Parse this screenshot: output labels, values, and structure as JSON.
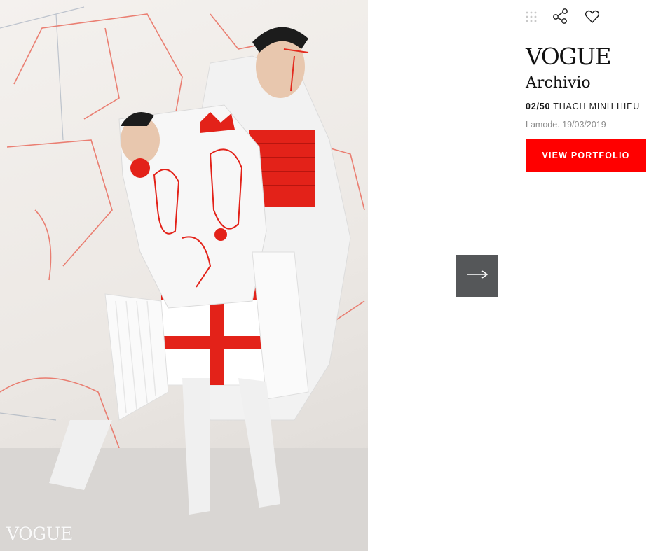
{
  "photo": {
    "watermark": "VOGUE"
  },
  "toolbar": {
    "icons": [
      "grid-icon",
      "share-icon",
      "heart-icon"
    ]
  },
  "brand": {
    "logo": "VOGUE",
    "sub": "Archivio"
  },
  "gallery": {
    "counter": "02/50",
    "designer": "THACH MINH HIEU",
    "meta": "Lamode. 19/03/2019",
    "portfolio_label": "VIEW PORTFOLIO"
  },
  "navigation": {
    "next_icon": "arrow-right-icon"
  },
  "colors": {
    "accent": "#ff0000",
    "nav_bg": "#555759",
    "muted_text": "#8b8b8b"
  }
}
